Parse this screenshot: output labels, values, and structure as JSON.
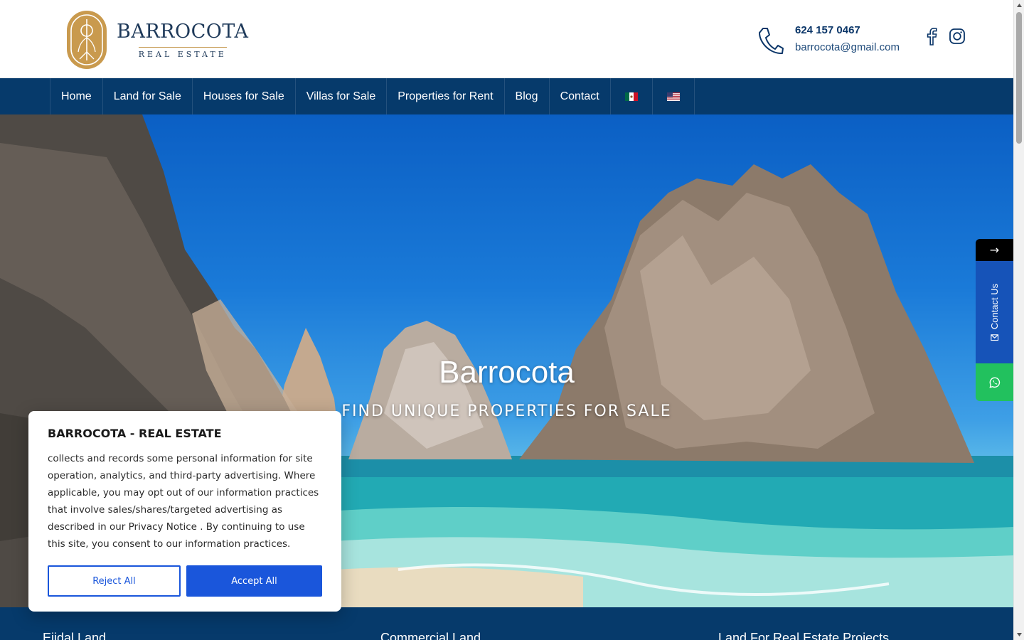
{
  "brand": {
    "name": "BARROCOTA",
    "tagline": "REAL ESTATE",
    "logo_icon": "barrocota-logo-emblem"
  },
  "contact": {
    "phone": "624 157 0467",
    "email": "barrocota@gmail.com",
    "phone_icon": "phone-icon"
  },
  "social": [
    {
      "name": "facebook-icon"
    },
    {
      "name": "instagram-icon"
    }
  ],
  "nav": {
    "items": [
      {
        "label": "Home"
      },
      {
        "label": "Land for Sale"
      },
      {
        "label": "Houses for Sale"
      },
      {
        "label": "Villas for Sale"
      },
      {
        "label": "Properties for Rent"
      },
      {
        "label": "Blog"
      },
      {
        "label": "Contact"
      }
    ],
    "flags": [
      {
        "name": "mexico-flag-icon"
      },
      {
        "name": "usa-flag-icon"
      }
    ]
  },
  "hero": {
    "title": "Barrocota",
    "subtitle": "FIND UNIQUE PROPERTIES FOR SALE"
  },
  "bottom_band": {
    "items": [
      {
        "label": "Ejidal Land"
      },
      {
        "label": "Commercial Land"
      },
      {
        "label": "Land For Real Estate Projects"
      }
    ]
  },
  "side_widget": {
    "arrow": "→",
    "contact_label": "Contact Us",
    "whatsapp_icon": "whatsapp-icon"
  },
  "cookie": {
    "title": "BARROCOTA - REAL ESTATE",
    "body": "collects and records some personal information for site operation, analytics, and third-party advertising. Where applicable, you may opt out of our information practices that involve sales/shares/targeted advertising as described in our Privacy Notice . By continuing to use this site, you consent to our information practices.",
    "reject_label": "Reject All",
    "accept_label": "Accept All"
  },
  "colors": {
    "nav_bg": "#063a6b",
    "brand_gold": "#c59a50",
    "accent_blue": "#1a56db",
    "whatsapp_green": "#22c15e"
  }
}
